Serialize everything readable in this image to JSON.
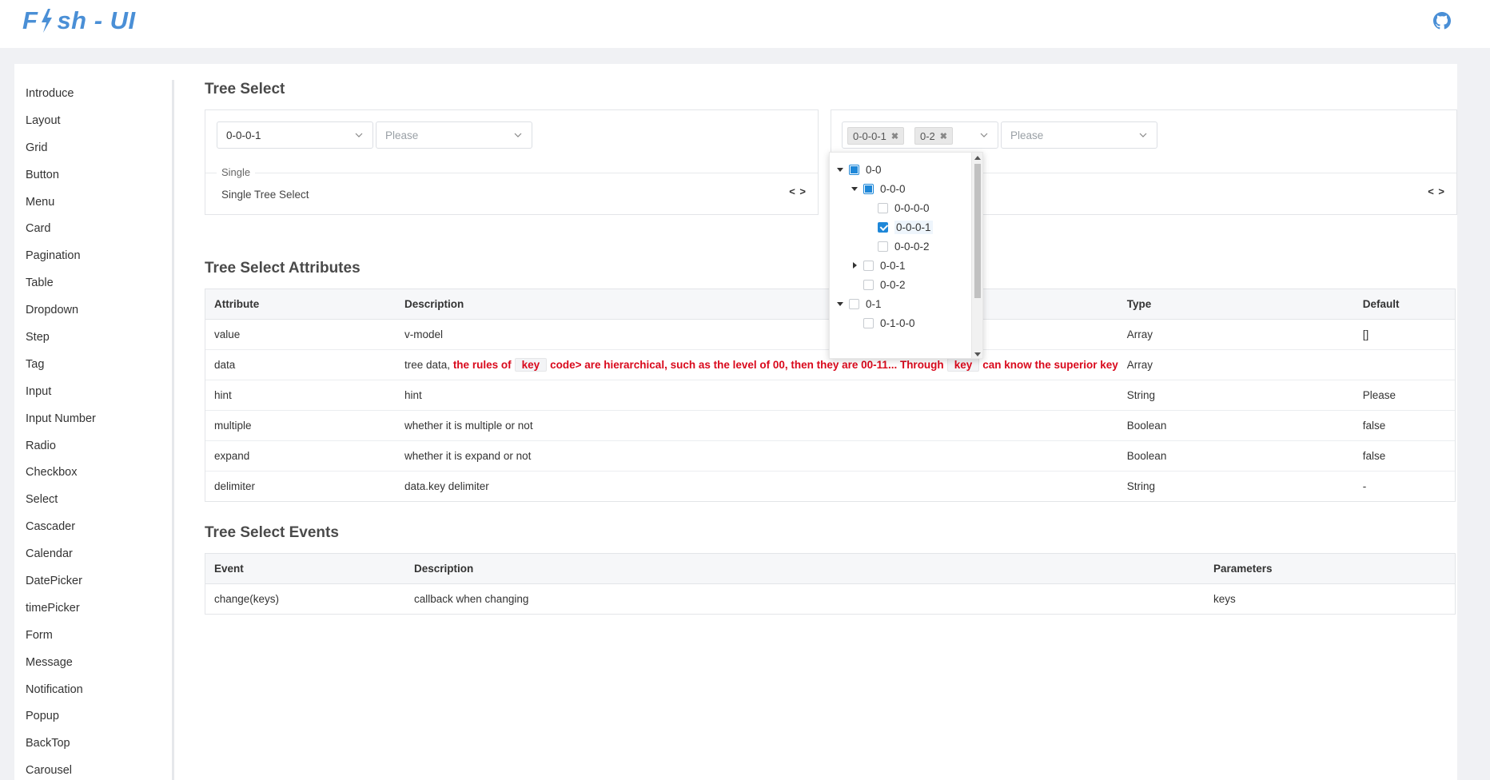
{
  "header": {
    "logo": "F⚡sh - UI",
    "logo_left": "F",
    "logo_right": "sh - UI",
    "github_icon": "github-icon"
  },
  "sidebar": {
    "items": [
      "Introduce",
      "Layout",
      "Grid",
      "Button",
      "Menu",
      "Card",
      "Pagination",
      "Table",
      "Dropdown",
      "Step",
      "Tag",
      "Input",
      "Input Number",
      "Radio",
      "Checkbox",
      "Select",
      "Cascader",
      "Calendar",
      "DatePicker",
      "timePicker",
      "Form",
      "Message",
      "Notification",
      "Popup",
      "BackTop",
      "Carousel"
    ]
  },
  "main": {
    "title": "Tree Select",
    "demo_single": {
      "select1_value": "0-0-0-1",
      "select2_placeholder": "Please",
      "legend": "Single",
      "description": "Single Tree Select",
      "code_toggle": "< >"
    },
    "demo_multiple": {
      "tags": [
        "0-0-0-1",
        "0-2"
      ],
      "select2_placeholder": "Please",
      "code_toggle": "< >"
    },
    "dropdown": {
      "nodes": [
        {
          "label": "0-0",
          "state": "partial",
          "expand": "open"
        },
        {
          "label": "0-0-0",
          "state": "partial",
          "expand": "open"
        },
        {
          "label": "0-0-0-0",
          "state": "unchecked",
          "expand": "none"
        },
        {
          "label": "0-0-0-1",
          "state": "checked",
          "expand": "none"
        },
        {
          "label": "0-0-0-2",
          "state": "unchecked",
          "expand": "none"
        },
        {
          "label": "0-0-1",
          "state": "unchecked",
          "expand": "closed"
        },
        {
          "label": "0-0-2",
          "state": "unchecked",
          "expand": "none"
        },
        {
          "label": "0-1",
          "state": "unchecked",
          "expand": "open"
        },
        {
          "label": "0-1-0-0",
          "state": "unchecked",
          "expand": "none"
        }
      ]
    },
    "attributes": {
      "title": "Tree Select Attributes",
      "headers": [
        "Attribute",
        "Description",
        "Type",
        "Default"
      ],
      "rows": [
        {
          "attr": "value",
          "desc": "v-model",
          "type": "Array",
          "default": "[]"
        },
        {
          "attr": "data",
          "desc_prefix": "tree data,",
          "desc_red_1": "the rules of",
          "desc_code_1": "key",
          "desc_red_2": "code> are hierarchical, such as the level of 00, then they are 00-11... Through",
          "desc_code_2": "key",
          "desc_red_3": "can know the superior key",
          "type": "Array",
          "default": ""
        },
        {
          "attr": "hint",
          "desc": "hint",
          "type": "String",
          "default": "Please"
        },
        {
          "attr": "multiple",
          "desc": "whether it is multiple or not",
          "type": "Boolean",
          "default": "false"
        },
        {
          "attr": "expand",
          "desc": "whether it is expand or not",
          "type": "Boolean",
          "default": "false"
        },
        {
          "attr": "delimiter",
          "desc": "data.key delimiter",
          "type": "String",
          "default": "-"
        }
      ]
    },
    "events": {
      "title": "Tree Select Events",
      "headers": [
        "Event",
        "Description",
        "Parameters"
      ],
      "rows": [
        {
          "event": "change(keys)",
          "desc": "callback when changing",
          "params": "keys"
        }
      ]
    }
  },
  "colors": {
    "accent": "#1e87d8",
    "logo": "#4a8fd6",
    "red": "#d9091c"
  }
}
